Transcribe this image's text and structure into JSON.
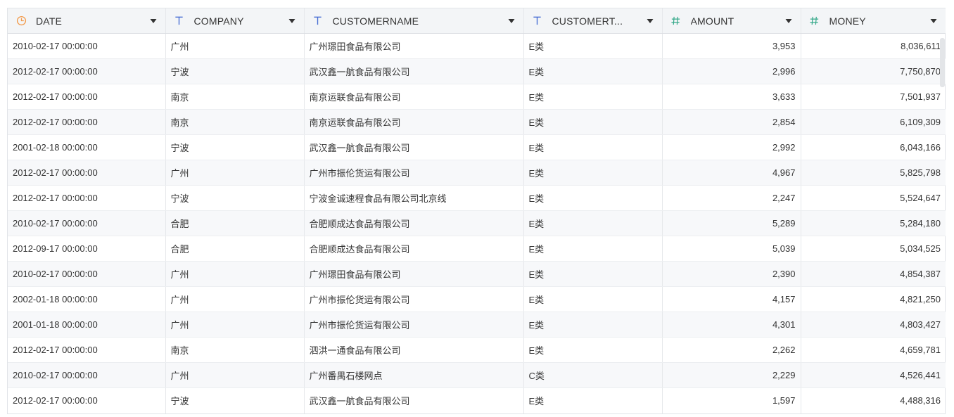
{
  "table": {
    "columns": [
      {
        "key": "date",
        "label": "DATE",
        "type_icon": "clock-icon"
      },
      {
        "key": "company",
        "label": "COMPANY",
        "type_icon": "text-type-icon"
      },
      {
        "key": "customername",
        "label": "CUSTOMERNAME",
        "type_icon": "text-type-icon"
      },
      {
        "key": "customertype",
        "label": "CUSTOMERT...",
        "type_icon": "text-type-icon"
      },
      {
        "key": "amount",
        "label": "AMOUNT",
        "type_icon": "number-type-icon"
      },
      {
        "key": "money",
        "label": "MONEY",
        "type_icon": "number-type-icon"
      }
    ],
    "rows": [
      [
        "2010-02-17 00:00:00",
        "广州",
        "广州璟田食品有限公司",
        "E类",
        "3,953",
        "8,036,611"
      ],
      [
        "2012-02-17 00:00:00",
        "宁波",
        "武汉鑫一航食品有限公司",
        "E类",
        "2,996",
        "7,750,870"
      ],
      [
        "2012-02-17 00:00:00",
        "南京",
        "南京运联食品有限公司",
        "E类",
        "3,633",
        "7,501,937"
      ],
      [
        "2012-02-17 00:00:00",
        "南京",
        "南京运联食品有限公司",
        "E类",
        "2,854",
        "6,109,309"
      ],
      [
        "2001-02-18 00:00:00",
        "宁波",
        "武汉鑫一航食品有限公司",
        "E类",
        "2,992",
        "6,043,166"
      ],
      [
        "2012-02-17 00:00:00",
        "广州",
        "广州市振伦货运有限公司",
        "E类",
        "4,967",
        "5,825,798"
      ],
      [
        "2012-02-17 00:00:00",
        "宁波",
        "宁波金诚速程食品有限公司北京线",
        "E类",
        "2,247",
        "5,524,647"
      ],
      [
        "2010-02-17 00:00:00",
        "合肥",
        "合肥顺成达食品有限公司",
        "E类",
        "5,289",
        "5,284,180"
      ],
      [
        "2012-09-17 00:00:00",
        "合肥",
        "合肥顺成达食品有限公司",
        "E类",
        "5,039",
        "5,034,525"
      ],
      [
        "2010-02-17 00:00:00",
        "广州",
        "广州璟田食品有限公司",
        "E类",
        "2,390",
        "4,854,387"
      ],
      [
        "2002-01-18 00:00:00",
        "广州",
        "广州市振伦货运有限公司",
        "E类",
        "4,157",
        "4,821,250"
      ],
      [
        "2001-01-18 00:00:00",
        "广州",
        "广州市振伦货运有限公司",
        "E类",
        "4,301",
        "4,803,427"
      ],
      [
        "2012-02-17 00:00:00",
        "南京",
        "泗洪一通食品有限公司",
        "E类",
        "2,262",
        "4,659,781"
      ],
      [
        "2010-02-17 00:00:00",
        "广州",
        "广州番禺石楼网点",
        "C类",
        "2,229",
        "4,526,441"
      ],
      [
        "2012-02-17 00:00:00",
        "宁波",
        "武汉鑫一航食品有限公司",
        "E类",
        "1,597",
        "4,488,316"
      ]
    ]
  },
  "colors": {
    "clock_icon": "#f29a4a",
    "text_type_icon": "#4a6fd4",
    "number_type_icon": "#35a98a",
    "caret": "#333333"
  }
}
